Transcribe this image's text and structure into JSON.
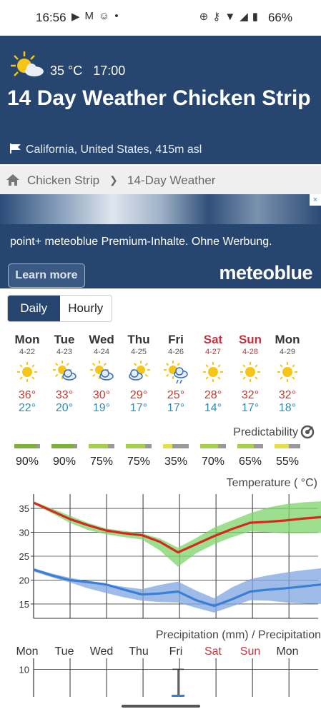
{
  "status": {
    "time": "16:56",
    "battery": "66%"
  },
  "header": {
    "current_temp": "35 °C",
    "current_time": "17:00",
    "title": "14 Day Weather Chicken Strip",
    "location": "California, United States, 415m asl"
  },
  "breadcrumb": {
    "item1": "Chicken Strip",
    "separator": "❯",
    "item2": "14-Day Weather"
  },
  "ad": {
    "text": "point+ meteoblue Premium-Inhalte. Ohne Werbung.",
    "button": "Learn more",
    "brand": "meteoblue",
    "info": "×"
  },
  "toggle": {
    "daily": "Daily",
    "hourly": "Hourly"
  },
  "days": [
    {
      "name": "Mon",
      "date": "4-22",
      "hi": "36°",
      "lo": "22°",
      "icon": "sun-icon",
      "weekend": false
    },
    {
      "name": "Tue",
      "date": "4-23",
      "hi": "33°",
      "lo": "20°",
      "icon": "sun-cloud-icon",
      "weekend": false
    },
    {
      "name": "Wed",
      "date": "4-24",
      "hi": "30°",
      "lo": "19°",
      "icon": "sun-cloud-icon",
      "weekend": false
    },
    {
      "name": "Thu",
      "date": "4-25",
      "hi": "29°",
      "lo": "17°",
      "icon": "cloud-sun-icon",
      "weekend": false
    },
    {
      "name": "Fri",
      "date": "4-26",
      "hi": "25°",
      "lo": "17°",
      "icon": "sun-rain-icon",
      "weekend": false
    },
    {
      "name": "Sat",
      "date": "4-27",
      "hi": "28°",
      "lo": "14°",
      "icon": "sun-icon",
      "weekend": true
    },
    {
      "name": "Sun",
      "date": "4-28",
      "hi": "32°",
      "lo": "17°",
      "icon": "sun-icon",
      "weekend": true
    },
    {
      "name": "Mon",
      "date": "4-29",
      "hi": "32°",
      "lo": "18°",
      "icon": "sun-icon",
      "weekend": false
    }
  ],
  "predictability": {
    "label": "Predictability",
    "values": [
      "90%",
      "90%",
      "75%",
      "75%",
      "35%",
      "70%",
      "65%",
      "55%"
    ],
    "colors": [
      "#7db03a",
      "#7db03a",
      "#a6cf4a",
      "#a6cf4a",
      "#e5dd4a",
      "#a6cf4a",
      "#a6cf4a",
      "#e5dd4a"
    ]
  },
  "temperature_chart": {
    "label": "Temperature ( °C)",
    "y_ticks": [
      "35",
      "30",
      "25",
      "20",
      "15"
    ]
  },
  "precipitation": {
    "label": "Precipitation (mm) / Precipitation",
    "y_ticks": [
      "10"
    ],
    "days": [
      "Mon",
      "Tue",
      "Wed",
      "Thu",
      "Fri",
      "Sat",
      "Sun",
      "Mon"
    ],
    "weekend": [
      false,
      false,
      false,
      false,
      false,
      true,
      true,
      false
    ]
  },
  "chart_data": [
    {
      "type": "line",
      "title": "Temperature ( °C)",
      "categories": [
        "Mon 4-22",
        "Tue 4-23",
        "Wed 4-24",
        "Thu 4-25",
        "Fri 4-26",
        "Sat 4-27",
        "Sun 4-28",
        "Mon 4-29"
      ],
      "x": [
        0,
        0.5,
        1,
        1.5,
        2,
        2.5,
        3,
        3.5,
        4,
        4.5,
        5,
        5.5,
        6,
        6.5,
        7,
        7.5,
        8
      ],
      "series": [
        {
          "values": [
            36.2,
            34.5,
            32.8,
            31.5,
            30.4,
            29.8,
            29.4,
            28.0,
            25.8,
            27.5,
            29.2,
            30.7,
            32.0,
            32.2,
            32.5,
            32.9,
            33.2
          ]
        },
        {
          "values": [
            22.2,
            21.0,
            20.0,
            19.6,
            19.1,
            18.0,
            17.0,
            17.2,
            17.6,
            15.8,
            14.6,
            16.0,
            17.6,
            18.0,
            18.3,
            18.7,
            19.1
          ]
        }
      ],
      "bands": [
        {
          "upper": [
            36.5,
            35.0,
            33.5,
            32.0,
            30.8,
            30.3,
            29.8,
            28.7,
            26.8,
            28.8,
            31.0,
            32.5,
            34.0,
            35.2,
            35.9,
            36.3,
            36.5
          ],
          "lower": [
            36.0,
            34.0,
            32.0,
            30.5,
            29.6,
            29.0,
            28.5,
            26.2,
            22.8,
            25.6,
            27.5,
            29.0,
            30.2,
            30.0,
            29.8,
            29.8,
            29.9
          ]
        },
        {
          "upper": [
            22.5,
            21.4,
            20.5,
            19.8,
            19.2,
            18.6,
            18.1,
            19.0,
            19.7,
            17.8,
            16.2,
            18.5,
            20.2,
            21.0,
            21.6,
            22.1,
            22.5
          ],
          "lower": [
            21.8,
            20.6,
            19.5,
            18.3,
            17.3,
            16.4,
            15.7,
            15.4,
            15.3,
            14.2,
            13.2,
            14.5,
            15.8,
            15.7,
            15.3,
            15.1,
            15.0
          ]
        }
      ],
      "series_colors": [
        "#d32a1e",
        "#3a7fd5"
      ],
      "band_colors": [
        "#7ed36a",
        "#7fa6e0"
      ],
      "yticks": [
        15,
        20,
        25,
        30,
        35
      ],
      "ylim": [
        12,
        38
      ],
      "grid": true
    },
    {
      "type": "bar",
      "title": "Precipitation (mm) / Precipitation",
      "categories": [
        "Mon",
        "Tue",
        "Wed",
        "Thu",
        "Fri",
        "Sat",
        "Sun",
        "Mon"
      ],
      "values": [
        0,
        0,
        0,
        0,
        0.5,
        0,
        0,
        0
      ],
      "whisker_max": [
        0,
        0,
        0,
        0,
        10,
        0,
        0,
        0
      ],
      "yticks": [
        10
      ],
      "ylim": [
        0,
        14
      ],
      "bar_color": "#3a7fd5"
    }
  ]
}
